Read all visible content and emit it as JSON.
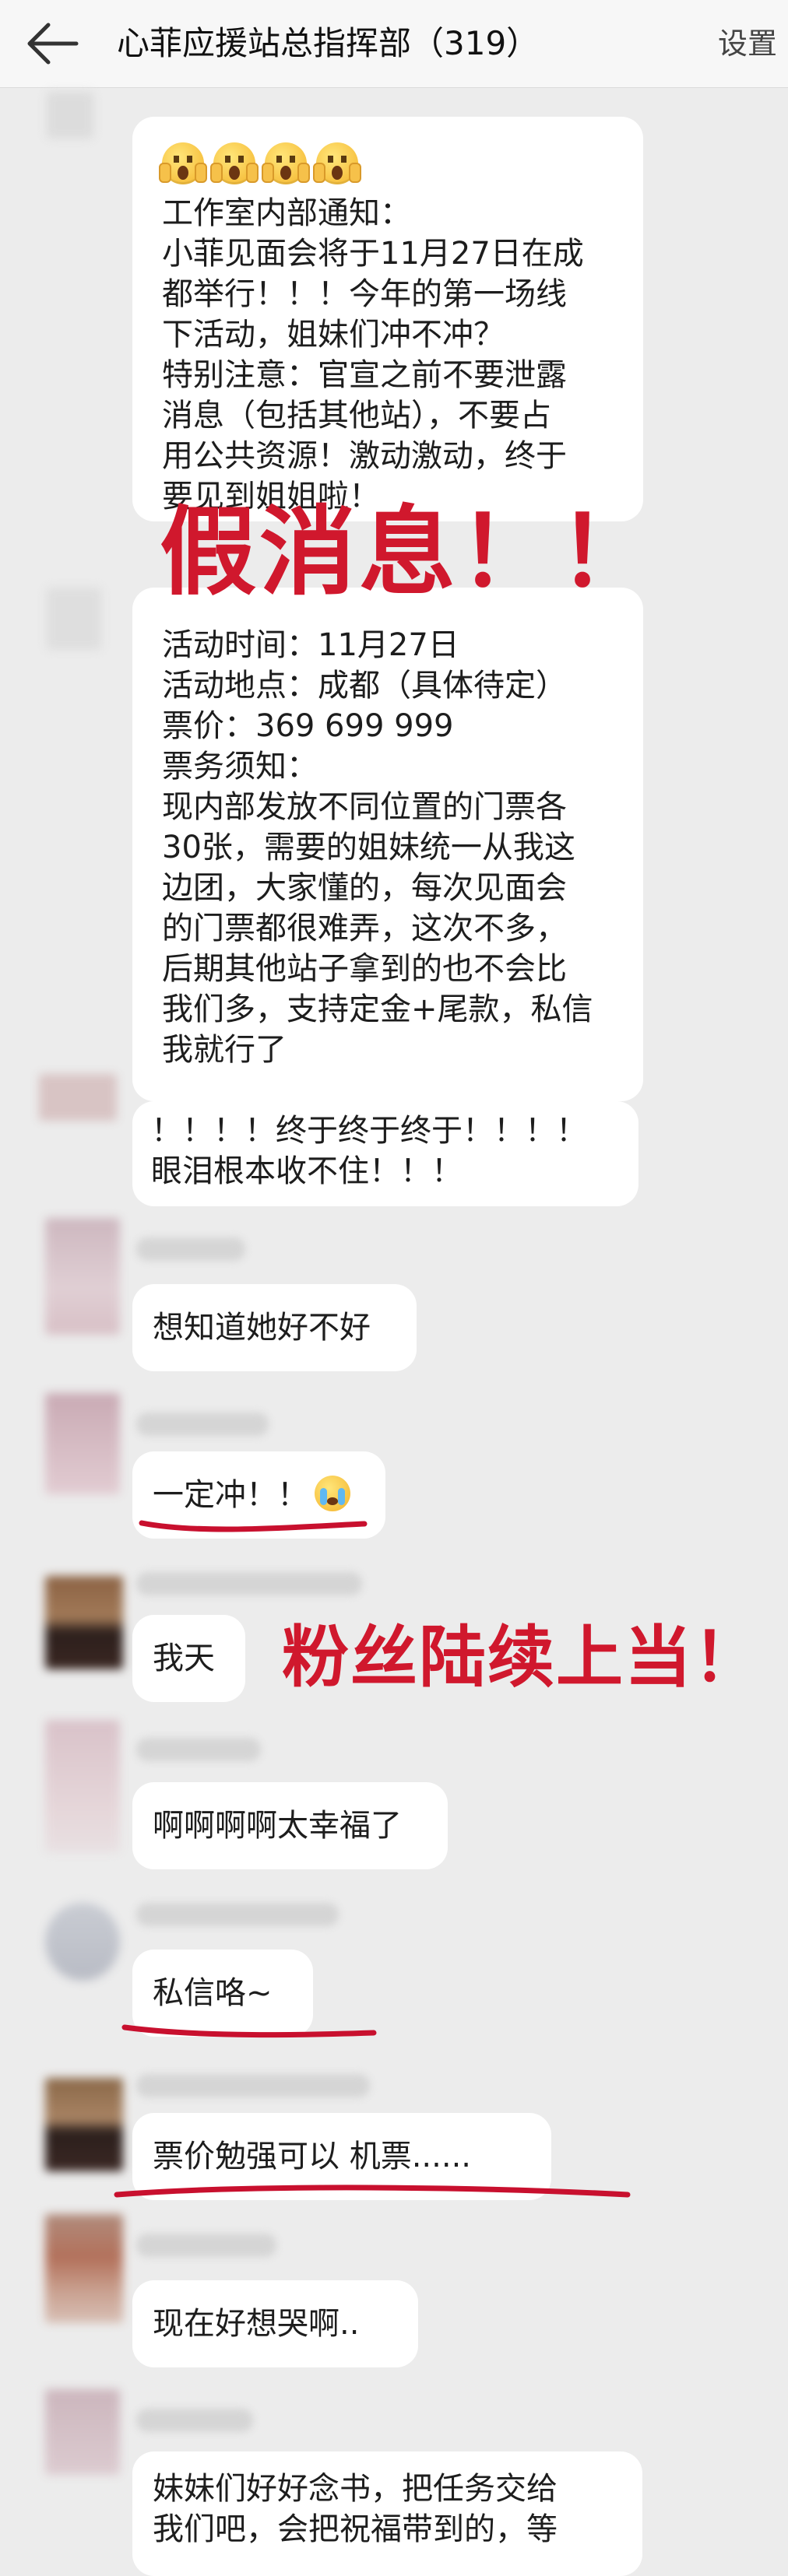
{
  "header": {
    "back_icon": "arrow-left-icon",
    "title": "心菲应援站总指挥部（319）",
    "settings_label": "设置"
  },
  "messages": {
    "announcement": {
      "emoji_icon": "shocked-face-emoji",
      "lines": [
        "工作室内部通知：",
        "小菲见面会将于11月27日在成",
        "都举行！！！今年的第一场线",
        "下活动，姐妹们冲不冲？",
        "特别注意：官宣之前不要泄露",
        "消息（包括其他站），不要占",
        "用公共资源！激动激动，终于",
        "要见到姐姐啦！"
      ]
    },
    "ticket_info": {
      "lines": [
        "活动时间：11月27日",
        "活动地点：成都（具体待定）",
        "票价：369  699  999",
        "票务须知：",
        "现内部发放不同位置的门票各",
        "30张，需要的姐妹统一从我这",
        "边团，大家懂的，每次见面会",
        "的门票都很难弄，这次不多，",
        "后期其他站子拿到的也不会比",
        "我们多，支持定金+尾款，私信",
        "我就行了"
      ]
    },
    "reply1": {
      "lines": [
        "！！！！终于终于终于！！！！",
        "眼泪根本收不住！！！"
      ]
    },
    "reply2": {
      "text": "想知道她好不好"
    },
    "reply3": {
      "text": "一定冲！！",
      "emoji_icon": "crying-face-emoji"
    },
    "reply4": {
      "text": "我天"
    },
    "reply5": {
      "text": "啊啊啊啊太幸福了"
    },
    "reply6": {
      "text": "私信咯~"
    },
    "reply7": {
      "text": "票价勉强可以 机票......"
    },
    "reply8": {
      "text": "现在好想哭啊.."
    },
    "reply9": {
      "lines": [
        "妹妹们好好念书，把任务交给",
        "我们吧，会把祝福带到的，等"
      ]
    }
  },
  "annotations": {
    "fake_news": "假消息！！",
    "fans_fooled": "粉丝陆续上当！",
    "underline_color": "#c8102e",
    "annotation_color": "#d0182d"
  }
}
